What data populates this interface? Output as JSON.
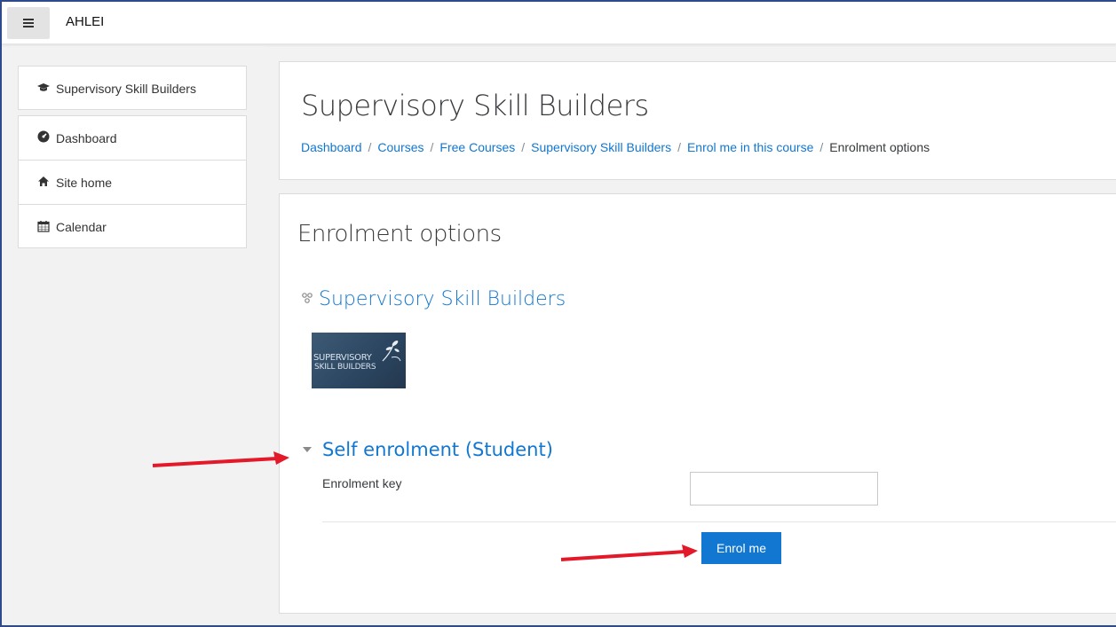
{
  "navbar": {
    "brand": "AHLEI",
    "menu_icon": "hamburger-icon"
  },
  "sidebar": {
    "course_item": {
      "label": "Supervisory Skill Builders",
      "icon": "graduation-cap-icon"
    },
    "items": [
      {
        "label": "Dashboard",
        "icon": "dashboard-icon"
      },
      {
        "label": "Site home",
        "icon": "home-icon"
      },
      {
        "label": "Calendar",
        "icon": "calendar-icon"
      }
    ]
  },
  "header": {
    "title": "Supervisory Skill Builders",
    "breadcrumb": [
      "Dashboard",
      "Courses",
      "Free Courses",
      "Supervisory Skill Builders",
      "Enrol me in this course"
    ],
    "breadcrumb_current": "Enrolment options",
    "separator": "/"
  },
  "content": {
    "section_title": "Enrolment options",
    "course_name": "Supervisory Skill Builders",
    "course_image_text_line1": "SUPERVISORY",
    "course_image_text_line2": "SKILL BUILDERS",
    "enrol_method": "Self enrolment (Student)",
    "field_label": "Enrolment key",
    "field_value": "",
    "button_label": "Enrol me"
  },
  "colors": {
    "link": "#1177d1",
    "button": "#1177d1",
    "annotation": "#e3192a"
  }
}
